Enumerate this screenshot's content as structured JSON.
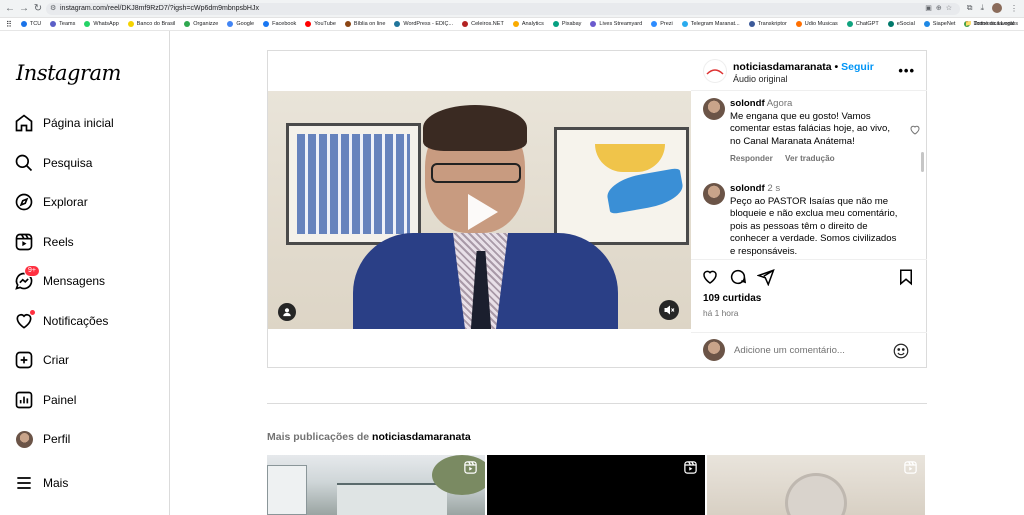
{
  "browser": {
    "url": "instagram.com/reel/DKJ8mf9RzD7/?igsh=cWp6dm9mbnpsbHJx",
    "bookmarks": [
      "TCU",
      "Teams",
      "WhatsApp",
      "Banco do Brasil",
      "Organizze",
      "Google",
      "Facebook",
      "YouTube",
      "Bíblia on line",
      "WordPress - EDIÇ...",
      "Celeiros.NET",
      "Analytics",
      "Pixabay",
      "Lives Streamyard",
      "Prezi",
      "Telegram Maranat...",
      "Transkriptor",
      "Udio Musicas",
      "ChatGPT",
      "eSocial",
      "SiapeNet",
      "Doméstica Legal"
    ],
    "bookmarks_all": "Todos os favoritos",
    "icon_colors": [
      "#1a73e8",
      "#5b5fc7",
      "#25d366",
      "#f5d300",
      "#2fa84f",
      "#4285f4",
      "#1877f2",
      "#ff0000",
      "#8b4513",
      "#21759b",
      "#b22222",
      "#f9ab00",
      "#05a081",
      "#6a5acd",
      "#2d8cff",
      "#2aabee",
      "#3c5a99",
      "#ff6f00",
      "#10a37f",
      "#00796b",
      "#1e88e5",
      "#43a047"
    ]
  },
  "sidebar": {
    "logo": "Instagram",
    "items": [
      {
        "label": "Página inicial",
        "icon": "home-icon"
      },
      {
        "label": "Pesquisa",
        "icon": "search-icon"
      },
      {
        "label": "Explorar",
        "icon": "compass-icon"
      },
      {
        "label": "Reels",
        "icon": "reels-icon"
      },
      {
        "label": "Mensagens",
        "icon": "messenger-icon",
        "badge": "9+"
      },
      {
        "label": "Notificações",
        "icon": "heart-icon"
      },
      {
        "label": "Criar",
        "icon": "plus-square-icon"
      },
      {
        "label": "Painel",
        "icon": "chart-icon"
      },
      {
        "label": "Perfil",
        "icon": "avatar"
      },
      {
        "label": "Mais",
        "icon": "menu-icon"
      }
    ]
  },
  "post": {
    "account": "noticiasdamaranata",
    "separator": "•",
    "follow_label": "Seguir",
    "audio": "Áudio original",
    "comments": [
      {
        "user": "solondf",
        "time": "Agora",
        "text": "Me engana que eu gosto! Vamos comentar estas falácias hoje, ao vivo, no Canal Maranata Anátema!",
        "reply": "Responder",
        "translate": "Ver tradução"
      },
      {
        "user": "solondf",
        "time": "2 s",
        "text": "Peço ao PASTOR Isaías que não me bloqueie e não exclua meu comentário, pois as pessoas têm o direito de conhecer a verdade. Somos civilizados e responsáveis."
      }
    ],
    "likes": "109 curtidas",
    "posted": "há 1 hora",
    "comment_placeholder": "Adicione um comentário..."
  },
  "more_posts": {
    "prefix": "Mais publicações de",
    "account": "noticiasdamaranata"
  }
}
